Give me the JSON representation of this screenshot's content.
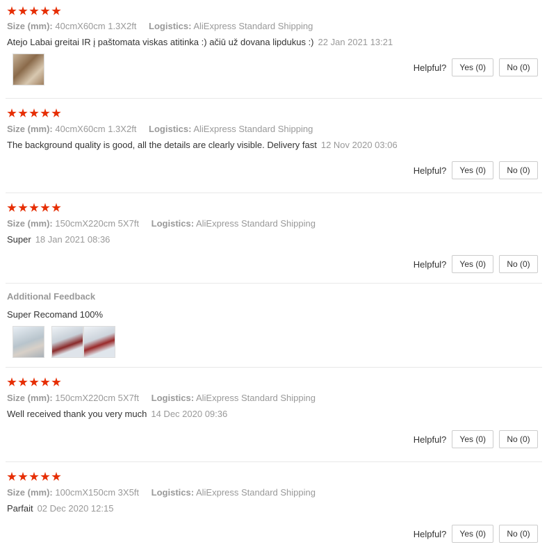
{
  "labels": {
    "size": "Size (mm):",
    "logistics": "Logistics:",
    "helpful": "Helpful?",
    "yes": "Yes (0)",
    "no": "No (0)",
    "additional_feedback": "Additional Feedback"
  },
  "colors": {
    "star": "#e62e04",
    "muted": "#999999",
    "text": "#333333"
  },
  "reviews": [
    {
      "rating": 5,
      "size": "40cmX60cm 1.3X2ft",
      "logistics": "AliExpress Standard Shipping",
      "text": "Atejo Labai greitai IR į paštomata viskas atitinka :) ačiū už dovana lipdukus :)",
      "date": "22 Jan 2021 13:21"
    },
    {
      "rating": 5,
      "size": "40cmX60cm 1.3X2ft",
      "logistics": "AliExpress Standard Shipping",
      "text": "The background quality is good, all the details are clearly visible. Delivery fast",
      "date": "12 Nov 2020 03:06"
    },
    {
      "rating": 5,
      "size": "150cmX220cm 5X7ft",
      "logistics": "AliExpress Standard Shipping",
      "text": "Super",
      "date": "18 Jan 2021 08:36",
      "additional": "Super Recomand 100%"
    },
    {
      "rating": 5,
      "size": "150cmX220cm 5X7ft",
      "logistics": "AliExpress Standard Shipping",
      "text": "Well received thank you very much",
      "date": "14 Dec 2020 09:36"
    },
    {
      "rating": 5,
      "size": "100cmX150cm 3X5ft",
      "logistics": "AliExpress Standard Shipping",
      "text": "Parfait",
      "date": "02 Dec 2020 12:15"
    }
  ]
}
